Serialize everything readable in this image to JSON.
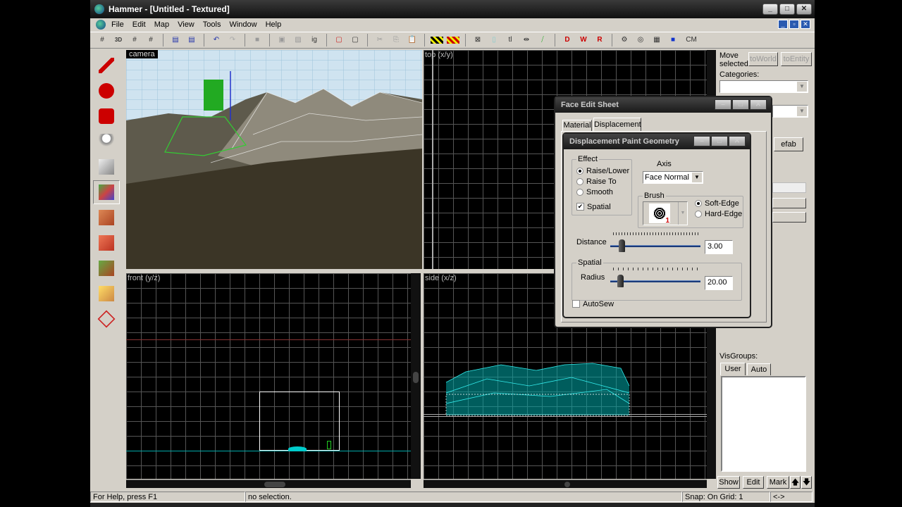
{
  "window": {
    "title": "Hammer - [Untitled - Textured]",
    "min": "_",
    "max": "□",
    "close": "✕"
  },
  "menu": [
    "File",
    "Edit",
    "Map",
    "View",
    "Tools",
    "Window",
    "Help"
  ],
  "toolbar": {
    "items": [
      "grid-icon",
      "3d-grid-icon",
      "smaller-grid-icon",
      "larger-grid-icon",
      "load-window-state-icon",
      "save-window-state-icon",
      "undo-icon",
      "redo-icon",
      "carve-icon",
      "group-icon",
      "ungroup-icon",
      "ignore-groups-icon",
      "hide-icon",
      "show-icon",
      "cut-icon",
      "copy-icon",
      "paste-icon",
      "texture-lock-icon",
      "texture-scale-lock-icon",
      "selection-box-icon",
      "select-by-handles-icon",
      "toggle-text-icon",
      "snap-icon",
      "flip-icon",
      "decal-icon",
      "overlay-icon",
      "radius-icon",
      "cordon-icon",
      "grid-toggle-icon",
      "texture-app-icon",
      "compile-icon"
    ],
    "ig_label": "ig",
    "tl_label": "tl",
    "cm_label": "CM"
  },
  "palette": [
    "selection-tool",
    "magnify-tool",
    "camera-tool",
    "entity-tool",
    "block-tool",
    "texture-application-tool",
    "apply-current-texture-tool",
    "decal-tool",
    "overlay-tool",
    "clipping-tool",
    "vertex-tool"
  ],
  "viewports": {
    "camera": "camera",
    "top": "top (x/y)",
    "front": "front (y/z)",
    "side": "side (x/z)"
  },
  "right_panel": {
    "move_selected": "Move selected:",
    "to_world": "toWorld",
    "to_entity": "toEntity",
    "categories": "Categories:",
    "prefab_fragment": "efab",
    "visgroups": "VisGroups:",
    "tab_user": "User",
    "tab_auto": "Auto",
    "show": "Show",
    "edit": "Edit",
    "mark": "Mark",
    "up": "🡅",
    "down": "🡇"
  },
  "face_edit": {
    "title": "Face Edit Sheet",
    "tab_material": "Material",
    "tab_displacement": "Displacement"
  },
  "disp_paint": {
    "title": "Displacement Paint Geometry",
    "effect_label": "Effect",
    "effects": [
      "Raise/Lower",
      "Raise To",
      "Smooth"
    ],
    "selected_effect": 0,
    "spatial_check": "Spatial",
    "spatial_checked": true,
    "axis_label": "Axis",
    "axis_value": "Face Normal",
    "brush_label": "Brush",
    "brush_number": "1",
    "edges": [
      "Soft-Edge",
      "Hard-Edge"
    ],
    "selected_edge": 0,
    "distance_label": "Distance",
    "distance_value": "3.00",
    "distance_fraction": 0.1,
    "spatial_group": "Spatial",
    "radius_label": "Radius",
    "radius_value": "20.00",
    "radius_fraction": 0.08,
    "autosew": "AutoSew",
    "autosew_checked": false
  },
  "status": {
    "help": "For Help, press F1",
    "selection": "no selection.",
    "snap": "Snap: On Grid: 1",
    "coords": "<->"
  }
}
